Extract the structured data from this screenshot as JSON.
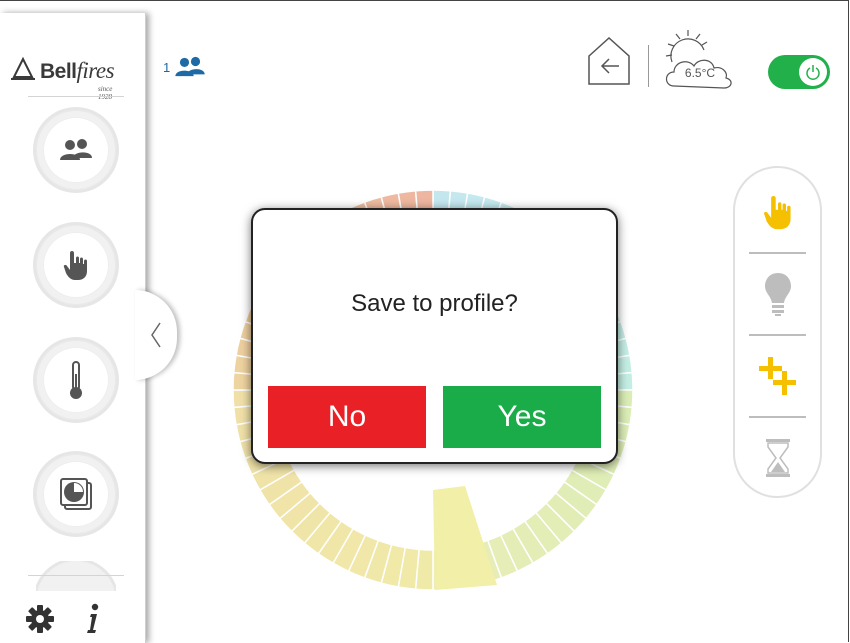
{
  "brand": {
    "name_bold": "Bell",
    "name_italic": "fires",
    "since": "since 1928"
  },
  "header": {
    "users_count": "1",
    "temperature": "6.5°C",
    "power_on": true
  },
  "sidebar": {
    "items": [
      {
        "name": "users",
        "icon": "users-icon"
      },
      {
        "name": "manual",
        "icon": "hand-icon"
      },
      {
        "name": "thermostat",
        "icon": "thermometer-icon"
      },
      {
        "name": "timer",
        "icon": "clock-icon"
      }
    ],
    "bottom": [
      {
        "icon": "gear-icon"
      },
      {
        "icon": "info-icon"
      }
    ]
  },
  "modes": [
    {
      "icon": "hand-icon",
      "active": true
    },
    {
      "icon": "bulb-icon",
      "active": false
    },
    {
      "icon": "plus-plus-icon",
      "active": true
    },
    {
      "icon": "hourglass-icon",
      "active": false
    }
  ],
  "dialog": {
    "title": "Save to profile?",
    "no_label": "No",
    "yes_label": "Yes"
  },
  "colors": {
    "accent_green": "#1aac49",
    "danger_red": "#e92126",
    "brand_blue": "#1e6aa6",
    "active_yellow": "#f5c000"
  }
}
